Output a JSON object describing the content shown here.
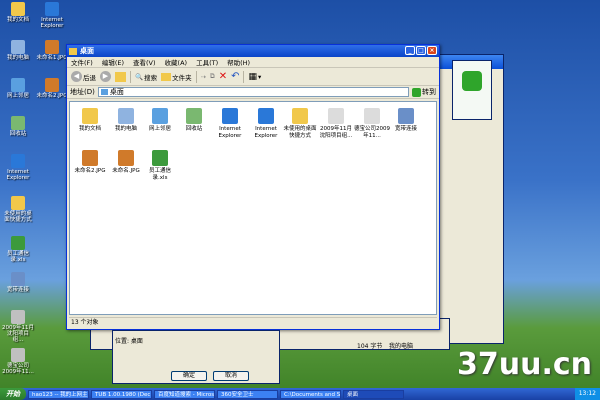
{
  "desktop": {
    "icons": [
      {
        "label": "我的文档",
        "color": "#f1c84b"
      },
      {
        "label": "Internet Explorer",
        "color": "#2a78d8"
      },
      {
        "label": "我的电脑",
        "color": "#8fb3e0"
      },
      {
        "label": "未命名1.JPG",
        "color": "#d07a2a"
      },
      {
        "label": "网上邻居",
        "color": "#5aa0e0"
      },
      {
        "label": "未命名2.JPG",
        "color": "#d07a2a"
      },
      {
        "label": "回收站",
        "color": "#7ab870"
      },
      {
        "label": "Internet Explorer",
        "color": "#2a78d8"
      },
      {
        "label": "未使用的桌面快捷方式",
        "color": "#f1c84b"
      },
      {
        "label": "员工通信录.xls",
        "color": "#3c9a3c"
      },
      {
        "label": "宽带连接",
        "color": "#6a8fc8"
      },
      {
        "label": "2009年11月沈阳项目组...",
        "color": "#c0c0c0"
      },
      {
        "label": "德宝公司2009年11...",
        "color": "#c0c0c0"
      }
    ]
  },
  "window": {
    "title": "桌面",
    "menu": [
      "文件(F)",
      "编辑(E)",
      "查看(V)",
      "收藏(A)",
      "工具(T)",
      "帮助(H)"
    ],
    "toolbar": {
      "back": "后退",
      "search": "搜索",
      "folders": "文件夹"
    },
    "address": {
      "label": "地址(D)",
      "value": "桌面",
      "go": "转到"
    },
    "files": [
      {
        "label": "我的文档",
        "color": "#f1c84b"
      },
      {
        "label": "我的电脑",
        "color": "#8fb3e0"
      },
      {
        "label": "网上邻居",
        "color": "#5aa0e0"
      },
      {
        "label": "回收站",
        "color": "#7ab870"
      },
      {
        "label": "Internet Explorer",
        "color": "#2a78d8"
      },
      {
        "label": "Internet Explorer",
        "color": "#2a78d8"
      },
      {
        "label": "未使用的桌面快捷方式",
        "color": "#f1c84b"
      },
      {
        "label": "2009年11月沈阳项目组...",
        "color": "#dcdcdc"
      },
      {
        "label": "德宝公司2009年11...",
        "color": "#dcdcdc"
      },
      {
        "label": "宽带连接",
        "color": "#6a8fc8"
      },
      {
        "label": "未命名2.JPG",
        "color": "#d07a2a"
      },
      {
        "label": "未命名.JPG",
        "color": "#d07a2a"
      },
      {
        "label": "员工通信录.xls",
        "color": "#3c9a3c"
      }
    ],
    "status": "13 个对象",
    "status2": "104 字节",
    "status3": "我的电脑"
  },
  "dialog": {
    "position": "位置: 桌面",
    "ok": "确定",
    "cancel": "取消"
  },
  "taskbar": {
    "start": "开始",
    "tasks": [
      "hao123 -- 我的上网主...",
      "TUB 1.00.1980 (Dec 10 ...",
      "百度知道搜索 - Micros...",
      "360安全卫士",
      "C:\\Documents and Settin...",
      "桌面"
    ],
    "clock": "13:12"
  },
  "background_side": {
    "label": "打开",
    "label2": "转到"
  },
  "watermark": "37uu.cn"
}
